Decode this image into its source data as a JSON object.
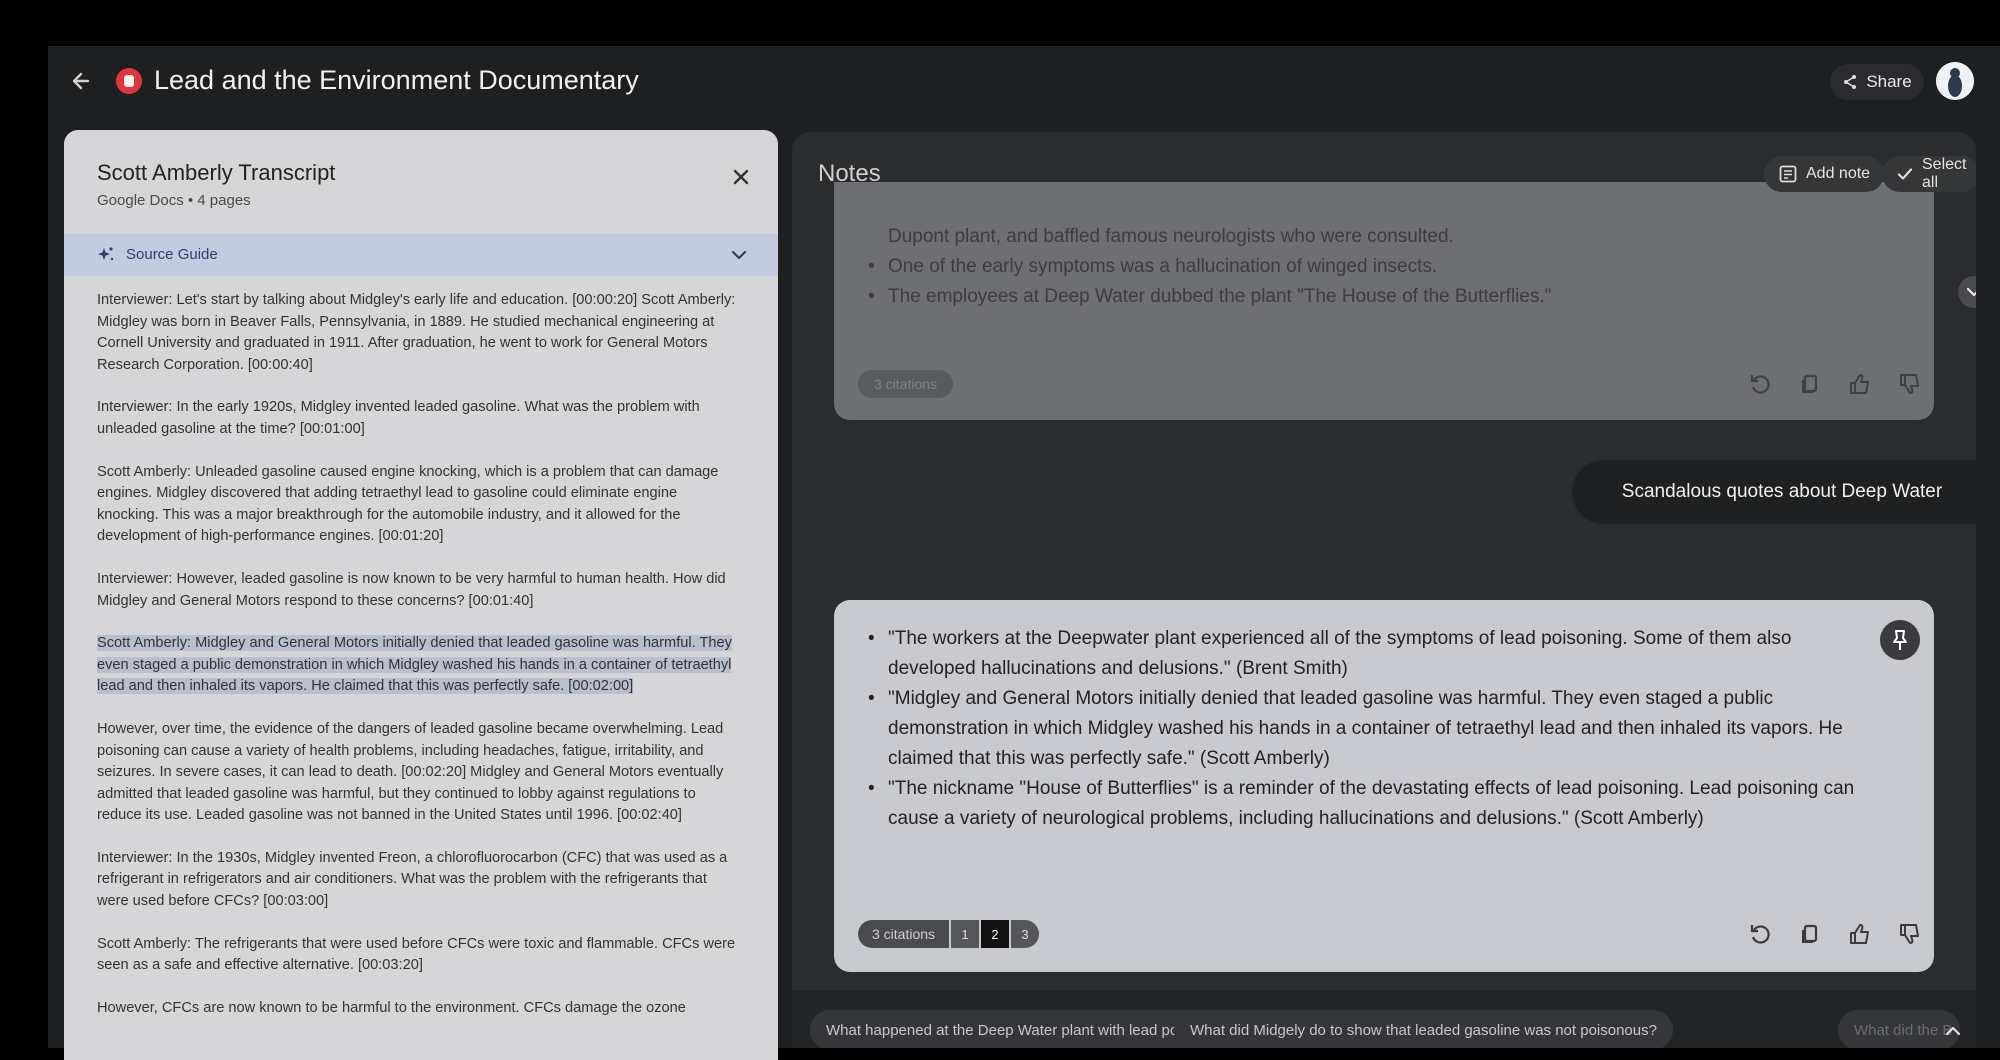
{
  "header": {
    "title": "Lead and the Environment Documentary",
    "share_label": "Share"
  },
  "source": {
    "title": "Scott Amberly Transcript",
    "meta": "Google Docs • 4 pages",
    "guide_label": "Source Guide",
    "paragraphs": [
      "Interviewer: Let's start by talking about Midgley's early life and education. [00:00:20] Scott Amberly: Midgley was born in Beaver Falls, Pennsylvania, in 1889. He studied mechanical engineering at Cornell University and graduated in 1911. After graduation, he went to work for General Motors Research Corporation. [00:00:40]",
      "Interviewer: In the early 1920s, Midgley invented leaded gasoline. What was the problem with unleaded gasoline at the time? [00:01:00]",
      "Scott Amberly: Unleaded gasoline caused engine knocking, which is a problem that can damage engines. Midgley discovered that adding tetraethyl lead to gasoline could eliminate engine knocking. This was a major breakthrough for the automobile industry, and it allowed for the development of high-performance engines. [00:01:20]",
      "Interviewer: However, leaded gasoline is now known to be very harmful to human health. How did Midgley and General Motors respond to these concerns? [00:01:40]",
      "Scott Amberly: Midgley and General Motors initially denied that leaded gasoline was harmful. They even staged a public demonstration in which Midgley washed his hands in a container of tetraethyl lead and then inhaled its vapors. He claimed that this was perfectly safe. [00:02:00]",
      "However, over time, the evidence of the dangers of leaded gasoline became overwhelming. Lead poisoning can cause a variety of health problems, including headaches, fatigue, irritability, and seizures. In severe cases, it can lead to death. [00:02:20] Midgley and General Motors eventually admitted that leaded gasoline was harmful, but they continued to lobby against regulations to reduce its use. Leaded gasoline was not banned in the United States until 1996. [00:02:40]",
      "Interviewer: In the 1930s, Midgley invented Freon, a chlorofluorocarbon (CFC) that was used as a refrigerant in refrigerators and air conditioners. What was the problem with the refrigerants that were used before CFCs? [00:03:00]",
      "Scott Amberly: The refrigerants that were used before CFCs were toxic and flammable. CFCs were seen as a safe and effective alternative. [00:03:20]",
      "However, CFCs are now known to be harmful to the environment. CFCs damage the ozone"
    ]
  },
  "notes": {
    "title": "Notes",
    "add_note_label": "Add note",
    "select_all_label": "Select all",
    "card1": {
      "lines": [
        "Dupont plant, and baffled famous neurologists who were consulted.",
        "One of the early symptoms was a hallucination of winged insects.",
        "The employees at Deep Water dubbed the plant \"The House of the Butterflies.\""
      ],
      "citations_label": "3 citations"
    },
    "query": "Scandalous quotes about Deep Water",
    "card2": {
      "bullets": [
        "\"The workers at the Deepwater plant experienced all of the symptoms of lead poisoning. Some of them also developed hallucinations and delusions.\" (Brent Smith)",
        "\"Midgley and General Motors initially denied that leaded gasoline was harmful. They even staged a public demonstration in which Midgley washed his hands in a container of tetraethyl lead and then inhaled its vapors. He claimed that this was perfectly safe.\" (Scott Amberly)",
        "\"The nickname \"House of Butterflies\" is a reminder of the devastating effects of lead poisoning. Lead poisoning can cause a variety of neurological problems, including hallucinations and delusions.\" (Scott Amberly)"
      ],
      "citations_label": "3 citations",
      "citation_numbers": [
        "1",
        "2",
        "3"
      ]
    },
    "suggestions": [
      "What happened at the Deep Water plant with lead poisoning?",
      "What did Midgely do to show that leaded gasoline was not poisonous?",
      "What did the B"
    ]
  },
  "colors": {
    "app_bg": "#1e1f21",
    "source_bg": "#d6d6d9",
    "guide_bg": "#c3cbe0",
    "highlight": "#b9bfcf",
    "card_bg": "#c9c9d0"
  }
}
